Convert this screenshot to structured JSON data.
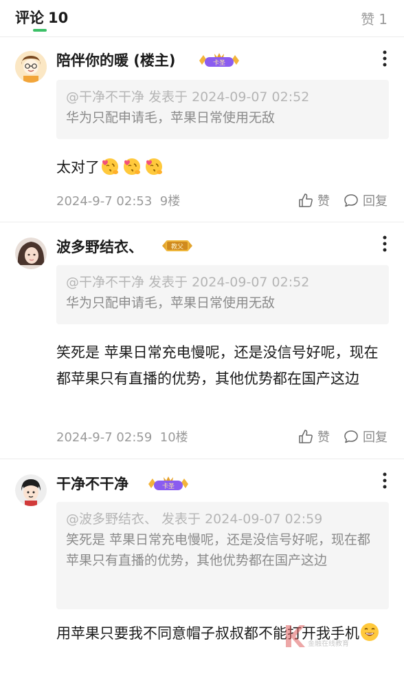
{
  "tabs": {
    "comments_label": "评论",
    "comments_count": "10",
    "likes_label": "赞",
    "likes_count": "1"
  },
  "accent_color": "#3cc067",
  "comments": [
    {
      "username": "陪伴你的暖 (楼主)",
      "badge": "卡圣",
      "quote_meta": "@干净不干净 发表于 2024-09-07 02:52",
      "quote_text": "华为只配申请毛，苹果日常使用无敌",
      "text": "太对了",
      "emoji": [
        "kiss-heart-emoji",
        "kiss-heart-emoji",
        "kiss-heart-emoji"
      ],
      "date": "2024-9-7 02:53",
      "floor": "9楼",
      "like_label": "赞",
      "reply_label": "回复"
    },
    {
      "username": "波多野结衣、",
      "badge": "教父",
      "quote_meta": "@干净不干净 发表于 2024-09-07 02:52",
      "quote_text": "华为只配申请毛，苹果日常使用无敌",
      "text": "笑死是 苹果日常充电慢呢，还是没信号好呢，现在都苹果只有直播的优势，其他优势都在国产这边",
      "date": "2024-9-7 02:59",
      "floor": "10楼",
      "like_label": "赞",
      "reply_label": "回复"
    },
    {
      "username": "干净不干净",
      "badge": "卡圣",
      "quote_meta": "@波多野结衣、 发表于 2024-09-07 02:59",
      "quote_text": "笑死是 苹果日常充电慢呢，还是没信号好呢，现在都苹果只有直播的优势，其他优势都在国产这边",
      "text": "用苹果只要我不同意帽子叔叔都不能打开我手机",
      "emoji": [
        "grin-emoji"
      ]
    }
  ],
  "watermark": "金融在线教育"
}
